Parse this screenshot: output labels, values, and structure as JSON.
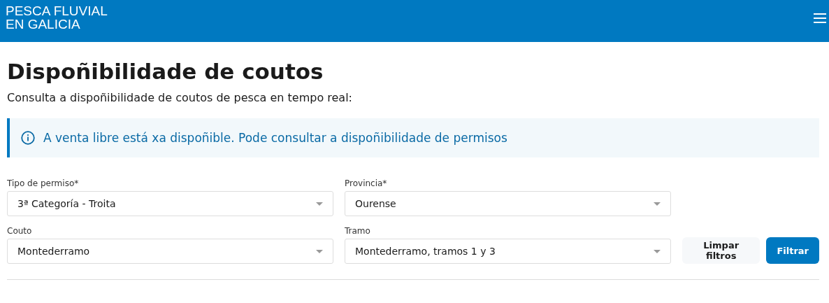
{
  "header": {
    "logo_lines": [
      "PESCA FLUVIAL",
      "EN GALICIA"
    ]
  },
  "title": "Dispoñibilidade de coutos",
  "subtitle": "Consulta a dispoñibilidade de coutos de pesca en tempo real:",
  "alert": {
    "text": "A venta libre está xa dispoñible. Pode consultar a dispoñibilidade de permisos"
  },
  "filters": [
    {
      "label": "Tipo de permiso*",
      "value": "3ª Categoría - Troita"
    },
    {
      "label": "Provincia*",
      "value": "Ourense"
    },
    {
      "label": "Couto",
      "value": "Montederramo"
    },
    {
      "label": "Tramo",
      "value": "Montederramo, tramos 1 y 3"
    }
  ],
  "buttons": [
    {
      "label": "Limpar filtros",
      "kind": "secondary"
    },
    {
      "label": "Filtrar",
      "kind": "primary"
    }
  ]
}
